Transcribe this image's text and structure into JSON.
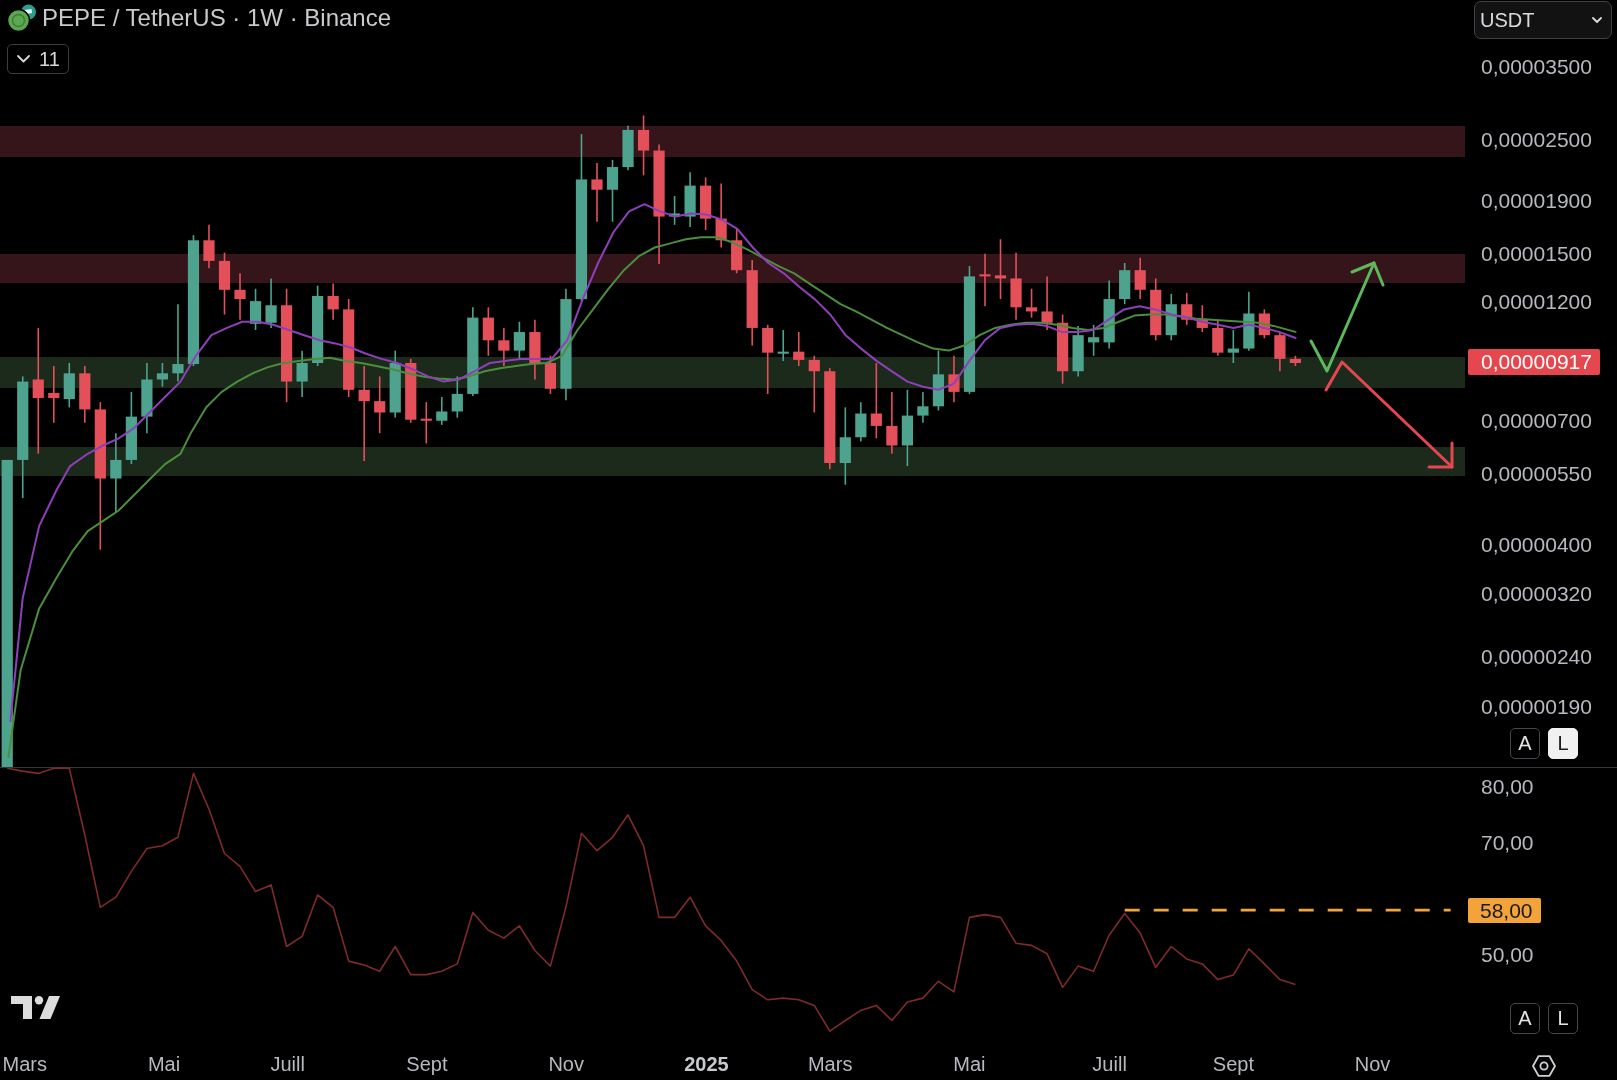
{
  "header": {
    "symbol_title": "PEPE / TetherUS · 1W · Binance",
    "indicators_toggle": {
      "count": "11",
      "expanded": false
    }
  },
  "currency_select": {
    "value": "USDT"
  },
  "price_pane": {
    "axis_labels": [
      "0,00003500",
      "0,00002500",
      "0,00001900",
      "0,00001500",
      "0,00001200",
      "0,00000700",
      "0,00000550",
      "0,00000400",
      "0,00000320",
      "0,00000240",
      "0,00000190"
    ],
    "last_price": "0,00000917",
    "scale_buttons": [
      {
        "label": "A",
        "selected": false
      },
      {
        "label": "L",
        "selected": true
      }
    ]
  },
  "rsi_pane": {
    "chart_data": {
      "type": "line",
      "ylim": [
        34.82,
        83.45
      ],
      "yticks": [
        {
          "value": 80,
          "label": "80,00"
        },
        {
          "value": 70,
          "label": "70,00"
        },
        {
          "value": 50,
          "label": "50,00"
        }
      ],
      "series": [
        {
          "color": "#7f2a2c",
          "values": [
            83.3,
            82.8,
            82.4,
            83.3,
            83.3,
            71.4,
            58.5,
            60.3,
            64.9,
            69.0,
            69.5,
            71.0,
            82.4,
            76.0,
            68.1,
            65.8,
            61.3,
            62.5,
            51.5,
            53.3,
            60.7,
            58.5,
            48.9,
            48.2,
            47.1,
            51.5,
            46.5,
            46.5,
            47.1,
            48.4,
            57.6,
            54.4,
            53.0,
            55.2,
            50.8,
            48.0,
            58.5,
            71.7,
            68.6,
            71.0,
            75.0,
            69.5,
            56.7,
            56.7,
            60.3,
            55.2,
            52.6,
            48.9,
            43.8,
            42.0,
            42.3,
            42.0,
            41.0,
            36.4,
            38.3,
            40.1,
            41.0,
            38.3,
            41.6,
            42.3,
            45.3,
            43.4,
            56.7,
            57.2,
            56.7,
            52.1,
            51.7,
            50.2,
            44.2,
            48.0,
            47.1,
            53.5,
            57.4,
            53.9,
            47.8,
            51.5,
            49.3,
            48.4,
            45.6,
            46.4,
            51.1,
            48.4,
            45.6,
            44.7,
            null,
            null,
            null,
            null,
            null,
            null,
            null,
            null,
            null,
            null
          ]
        },
        {
          "color": "#f2a33a",
          "line_style": "dashed",
          "values": [
            null,
            null,
            null,
            null,
            null,
            null,
            null,
            null,
            null,
            null,
            null,
            null,
            null,
            null,
            null,
            null,
            null,
            null,
            null,
            null,
            null,
            null,
            null,
            null,
            null,
            null,
            null,
            null,
            null,
            null,
            null,
            null,
            null,
            null,
            null,
            null,
            null,
            null,
            null,
            null,
            null,
            null,
            null,
            null,
            null,
            null,
            null,
            null,
            null,
            null,
            null,
            null,
            null,
            null,
            null,
            null,
            null,
            null,
            null,
            null,
            null,
            null,
            null,
            null,
            null,
            null,
            null,
            null,
            null,
            null,
            null,
            null,
            58,
            58,
            58,
            58,
            58,
            58,
            58,
            58,
            58,
            58,
            58,
            58,
            58,
            58,
            58,
            58,
            58,
            58,
            58,
            58,
            58,
            58
          ]
        }
      ]
    },
    "level_tag": {
      "label": "58,00"
    },
    "scale_buttons": [
      {
        "label": "A",
        "selected": false
      },
      {
        "label": "L",
        "selected": false
      }
    ]
  },
  "time_axis": [
    {
      "label": "Mars",
      "kind": "month"
    },
    {
      "label": "Mai",
      "kind": "month"
    },
    {
      "label": "Juill",
      "kind": "month"
    },
    {
      "label": "Sept",
      "kind": "month"
    },
    {
      "label": "Nov",
      "kind": "month"
    },
    {
      "label": "2025",
      "kind": "year"
    },
    {
      "label": "Mars",
      "kind": "month"
    },
    {
      "label": "Mai",
      "kind": "month"
    },
    {
      "label": "Juill",
      "kind": "month"
    },
    {
      "label": "Sept",
      "kind": "month"
    },
    {
      "label": "Nov",
      "kind": "month"
    }
  ]
}
